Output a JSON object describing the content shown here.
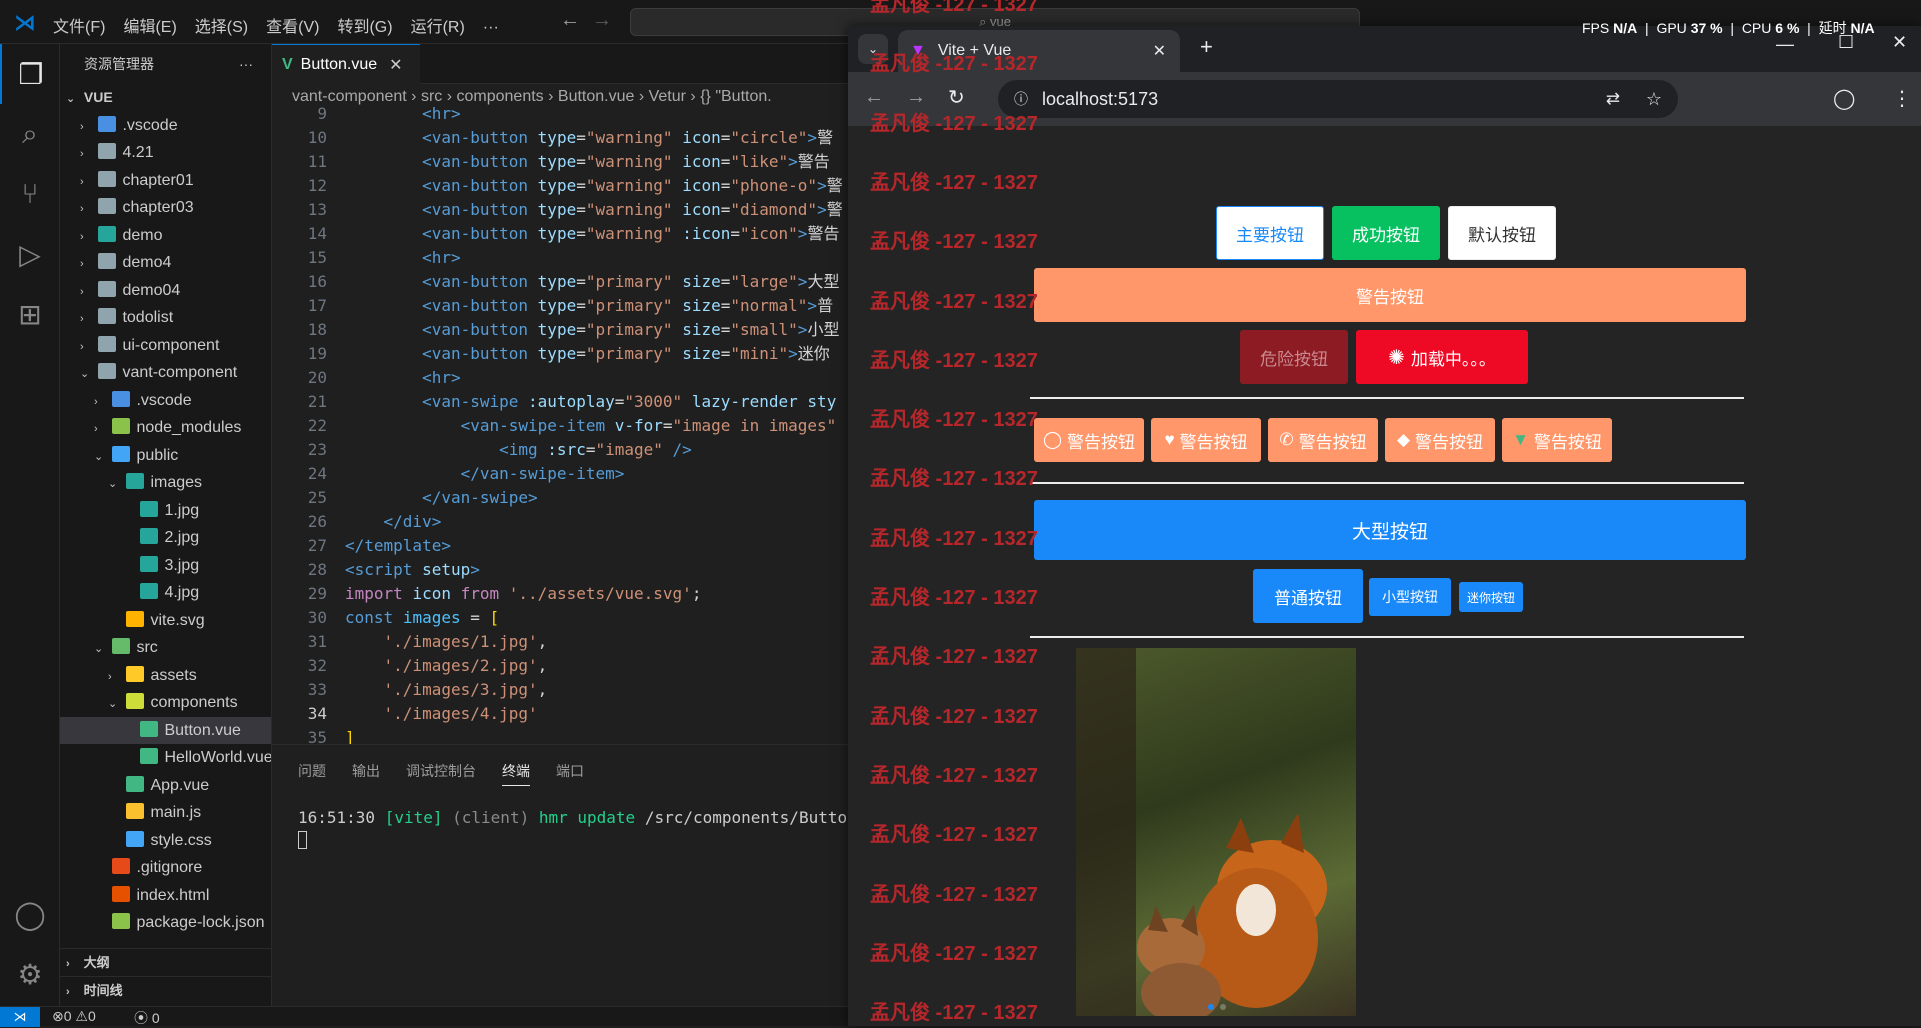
{
  "titlebar": {
    "menus": [
      "文件(F)",
      "编辑(E)",
      "选择(S)",
      "查看(V)",
      "转到(G)",
      "运行(R)",
      "···"
    ],
    "search_placeholder": "vue"
  },
  "overlay": {
    "fps_label": "FPS",
    "fps": "N/A",
    "gpu_label": "GPU",
    "gpu": "37 %",
    "cpu_label": "CPU",
    "cpu": "6 %",
    "latency_label": "延时",
    "latency": "N/A"
  },
  "sidebar": {
    "title": "资源管理器",
    "more": "···",
    "root": "VUE",
    "items": [
      {
        "label": ".vscode",
        "d": 1,
        "tw": "›",
        "c": "#4a90e2"
      },
      {
        "label": "4.21",
        "d": 1,
        "tw": "›",
        "c": "#90a4ae"
      },
      {
        "label": "chapter01",
        "d": 1,
        "tw": "›",
        "c": "#90a4ae"
      },
      {
        "label": "chapter03",
        "d": 1,
        "tw": "›",
        "c": "#90a4ae"
      },
      {
        "label": "demo",
        "d": 1,
        "tw": "›",
        "c": "#26a69a"
      },
      {
        "label": "demo4",
        "d": 1,
        "tw": "›",
        "c": "#90a4ae"
      },
      {
        "label": "demo04",
        "d": 1,
        "tw": "›",
        "c": "#90a4ae"
      },
      {
        "label": "todolist",
        "d": 1,
        "tw": "›",
        "c": "#90a4ae"
      },
      {
        "label": "ui-component",
        "d": 1,
        "tw": "›",
        "c": "#90a4ae"
      },
      {
        "label": "vant-component",
        "d": 1,
        "tw": "⌄",
        "c": "#90a4ae"
      },
      {
        "label": ".vscode",
        "d": 2,
        "tw": "›",
        "c": "#4a90e2"
      },
      {
        "label": "node_modules",
        "d": 2,
        "tw": "›",
        "c": "#8bc34a"
      },
      {
        "label": "public",
        "d": 2,
        "tw": "⌄",
        "c": "#42a5f5"
      },
      {
        "label": "images",
        "d": 3,
        "tw": "⌄",
        "c": "#26a69a"
      },
      {
        "label": "1.jpg",
        "d": 4,
        "tw": "",
        "c": "#26a69a"
      },
      {
        "label": "2.jpg",
        "d": 4,
        "tw": "",
        "c": "#26a69a"
      },
      {
        "label": "3.jpg",
        "d": 4,
        "tw": "",
        "c": "#26a69a"
      },
      {
        "label": "4.jpg",
        "d": 4,
        "tw": "",
        "c": "#26a69a"
      },
      {
        "label": "vite.svg",
        "d": 3,
        "tw": "",
        "c": "#ffb300"
      },
      {
        "label": "src",
        "d": 2,
        "tw": "⌄",
        "c": "#66bb6a"
      },
      {
        "label": "assets",
        "d": 3,
        "tw": "›",
        "c": "#ffca28"
      },
      {
        "label": "components",
        "d": 3,
        "tw": "⌄",
        "c": "#cddc39"
      },
      {
        "label": "Button.vue",
        "d": 4,
        "tw": "",
        "c": "#41b883",
        "sel": true
      },
      {
        "label": "HelloWorld.vue",
        "d": 4,
        "tw": "",
        "c": "#41b883"
      },
      {
        "label": "App.vue",
        "d": 3,
        "tw": "",
        "c": "#41b883"
      },
      {
        "label": "main.js",
        "d": 3,
        "tw": "",
        "c": "#fbc02d"
      },
      {
        "label": "style.css",
        "d": 3,
        "tw": "",
        "c": "#42a5f5"
      },
      {
        "label": ".gitignore",
        "d": 2,
        "tw": "",
        "c": "#e64a19"
      },
      {
        "label": "index.html",
        "d": 2,
        "tw": "",
        "c": "#e65100"
      },
      {
        "label": "package-lock.json",
        "d": 2,
        "tw": "",
        "c": "#8bc34a"
      }
    ],
    "outline": "大纲",
    "timeline": "时间线"
  },
  "editor": {
    "tab": "Button.vue",
    "breadcrumb": [
      "vant-component",
      "src",
      "components",
      "Button.vue",
      "Vetur",
      "{} \"Button."
    ],
    "lines": [
      {
        "n": "9",
        "h": "        <span class='tg'>&lt;hr&gt;</span>"
      },
      {
        "n": "10",
        "h": "        <span class='tg'>&lt;van-button</span> <span class='at'>type</span><span class='tx'>=</span><span class='st'>\"warning\"</span> <span class='at'>icon</span><span class='tx'>=</span><span class='st'>\"circle\"</span><span class='tg'>&gt;</span><span class='tx'>警</span>"
      },
      {
        "n": "11",
        "h": "        <span class='tg'>&lt;van-button</span> <span class='at'>type</span><span class='tx'>=</span><span class='st'>\"warning\"</span> <span class='at'>icon</span><span class='tx'>=</span><span class='st'>\"like\"</span><span class='tg'>&gt;</span><span class='tx'>警告</span>"
      },
      {
        "n": "12",
        "h": "        <span class='tg'>&lt;van-button</span> <span class='at'>type</span><span class='tx'>=</span><span class='st'>\"warning\"</span> <span class='at'>icon</span><span class='tx'>=</span><span class='st'>\"phone-o\"</span><span class='tg'>&gt;</span><span class='tx'>警</span>"
      },
      {
        "n": "13",
        "h": "        <span class='tg'>&lt;van-button</span> <span class='at'>type</span><span class='tx'>=</span><span class='st'>\"warning\"</span> <span class='at'>icon</span><span class='tx'>=</span><span class='st'>\"diamond\"</span><span class='tg'>&gt;</span><span class='tx'>警</span>"
      },
      {
        "n": "14",
        "h": "        <span class='tg'>&lt;van-button</span> <span class='at'>type</span><span class='tx'>=</span><span class='st'>\"warning\"</span> <span class='at'>:icon</span><span class='tx'>=</span><span class='st'>\"icon\"</span><span class='tg'>&gt;</span><span class='tx'>警告</span>"
      },
      {
        "n": "15",
        "h": "        <span class='tg'>&lt;hr&gt;</span>"
      },
      {
        "n": "16",
        "h": "        <span class='tg'>&lt;van-button</span> <span class='at'>type</span><span class='tx'>=</span><span class='st'>\"primary\"</span> <span class='at'>size</span><span class='tx'>=</span><span class='st'>\"large\"</span><span class='tg'>&gt;</span><span class='tx'>大型</span>"
      },
      {
        "n": "17",
        "h": "        <span class='tg'>&lt;van-button</span> <span class='at'>type</span><span class='tx'>=</span><span class='st'>\"primary\"</span> <span class='at'>size</span><span class='tx'>=</span><span class='st'>\"normal\"</span><span class='tg'>&gt;</span><span class='tx'>普</span>"
      },
      {
        "n": "18",
        "h": "        <span class='tg'>&lt;van-button</span> <span class='at'>type</span><span class='tx'>=</span><span class='st'>\"primary\"</span> <span class='at'>size</span><span class='tx'>=</span><span class='st'>\"small\"</span><span class='tg'>&gt;</span><span class='tx'>小型</span>"
      },
      {
        "n": "19",
        "h": "        <span class='tg'>&lt;van-button</span> <span class='at'>type</span><span class='tx'>=</span><span class='st'>\"primary\"</span> <span class='at'>size</span><span class='tx'>=</span><span class='st'>\"mini\"</span><span class='tg'>&gt;</span><span class='tx'>迷你</span>"
      },
      {
        "n": "20",
        "h": "        <span class='tg'>&lt;hr&gt;</span>"
      },
      {
        "n": "21",
        "h": "        <span class='tg'>&lt;van-swipe</span> <span class='at'>:autoplay</span><span class='tx'>=</span><span class='st'>\"3000\"</span> <span class='at'>lazy-render</span> <span class='at'>sty</span>"
      },
      {
        "n": "22",
        "h": "            <span class='tg'>&lt;van-swipe-item</span> <span class='at'>v-for</span><span class='tx'>=</span><span class='st'>\"image in images\"</span>"
      },
      {
        "n": "23",
        "h": "                <span class='tg'>&lt;img</span> <span class='at'>:src</span><span class='tx'>=</span><span class='st'>\"image\"</span> <span class='tg'>/&gt;</span>"
      },
      {
        "n": "24",
        "h": "            <span class='tg'>&lt;/van-swipe-item&gt;</span>"
      },
      {
        "n": "25",
        "h": "        <span class='tg'>&lt;/van-swipe&gt;</span>"
      },
      {
        "n": "26",
        "h": "    <span class='tg'>&lt;/div&gt;</span>"
      },
      {
        "n": "27",
        "h": "<span class='tg'>&lt;/template&gt;</span>"
      },
      {
        "n": "28",
        "h": "<span class='tg'>&lt;script</span> <span class='at'>setup</span><span class='tg'>&gt;</span>"
      },
      {
        "n": "29",
        "h": "<span class='kw'>import</span> <span class='at'>icon</span> <span class='kw'>from</span> <span class='st'>'../assets/vue.svg'</span><span class='tx'>;</span>"
      },
      {
        "n": "30",
        "h": "<span class='tg'>const</span> <span class='bl'>images</span> <span class='tx'>=</span> <span class='yl'>[</span>"
      },
      {
        "n": "31",
        "h": "    <span class='st'>'./images/1.jpg'</span><span class='tx'>,</span>"
      },
      {
        "n": "32",
        "h": "    <span class='st'>'./images/2.jpg'</span><span class='tx'>,</span>"
      },
      {
        "n": "33",
        "h": "    <span class='st'>'./images/3.jpg'</span><span class='tx'>,</span>"
      },
      {
        "n": "34",
        "h": "    <span class='st'>'./images/4.jpg'</span>"
      },
      {
        "n": "35",
        "h": "<span class='yl'>]</span>"
      }
    ]
  },
  "panel": {
    "tabs": [
      "问题",
      "输出",
      "调试控制台",
      "终端",
      "端口"
    ],
    "time": "16:51:30",
    "vite": "[vite]",
    "client": "(client)",
    "hmr": "hmr update",
    "path": "/src/components/Button.vu"
  },
  "statusbar": {
    "errors": "0",
    "warnings": "0",
    "ports": "0"
  },
  "browser": {
    "tab_title": "Vite + Vue",
    "url": "localhost:5173",
    "watermark": "孟凡俊 -127 - 1327",
    "row1": [
      "主要按钮",
      "成功按钮",
      "默认按钮"
    ],
    "warning_wide": "警告按钮",
    "danger": "危险按钮",
    "loading": "加载中。。。",
    "icon_buttons": [
      {
        "icon": "circle-icon",
        "label": "警告按钮"
      },
      {
        "icon": "heart-icon",
        "label": "警告按钮"
      },
      {
        "icon": "phone-icon",
        "label": "警告按钮"
      },
      {
        "icon": "diamond-icon",
        "label": "警告按钮"
      },
      {
        "icon": "vue-logo-icon",
        "label": "警告按钮"
      }
    ],
    "large": "大型按钮",
    "normal": "普通按钮",
    "small": "小型按钮",
    "mini": "迷你按钮"
  }
}
